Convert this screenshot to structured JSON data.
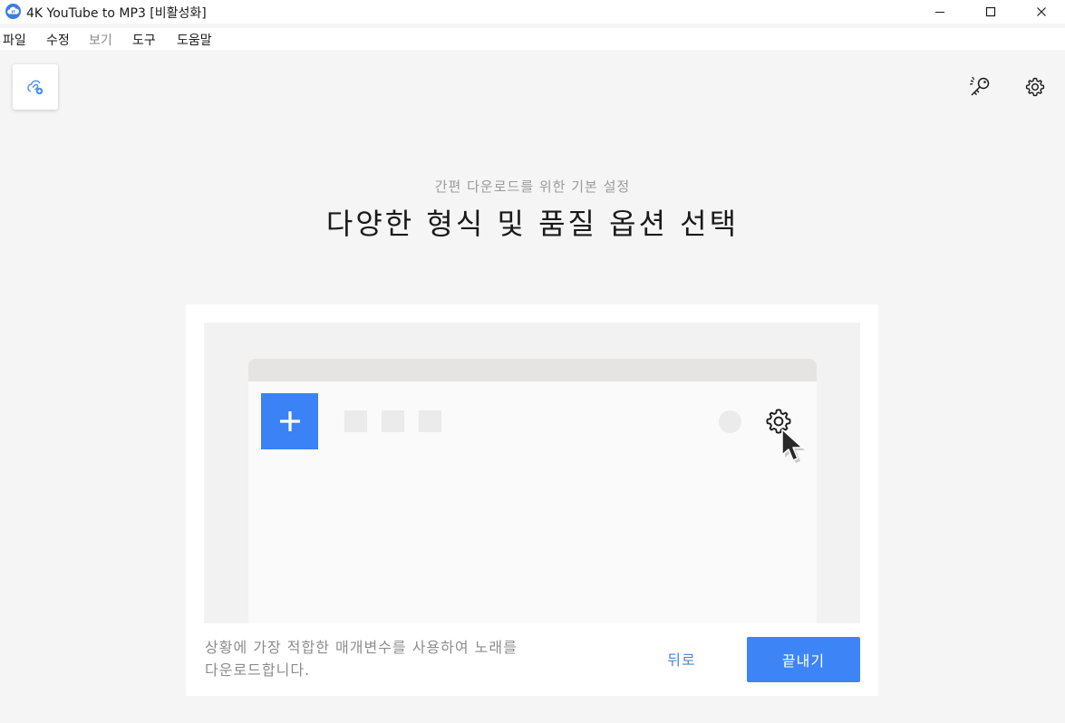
{
  "window": {
    "title": "4K YouTube to MP3 [비활성화]",
    "accent_color": "#3d84f7"
  },
  "menu": {
    "items": [
      {
        "label": "파일",
        "disabled": false
      },
      {
        "label": "수정",
        "disabled": false
      },
      {
        "label": "보기",
        "disabled": true
      },
      {
        "label": "도구",
        "disabled": false
      },
      {
        "label": "도움말",
        "disabled": false
      }
    ]
  },
  "toolbar": {
    "add_link_icon": "cloud-link-add-icon",
    "license_icon": "key-icon",
    "settings_icon": "gear-icon"
  },
  "onboarding": {
    "subtitle": "간편 다운로드를 위한 기본 설정",
    "headline": "다양한 형식 및 품질 옵션 선택",
    "description_line1": "상황에 가장 적합한 매개변수를 사용하여 노래를",
    "description_line2": "다운로드합니다.",
    "back_label": "뒤로",
    "finish_label": "끝내기"
  }
}
